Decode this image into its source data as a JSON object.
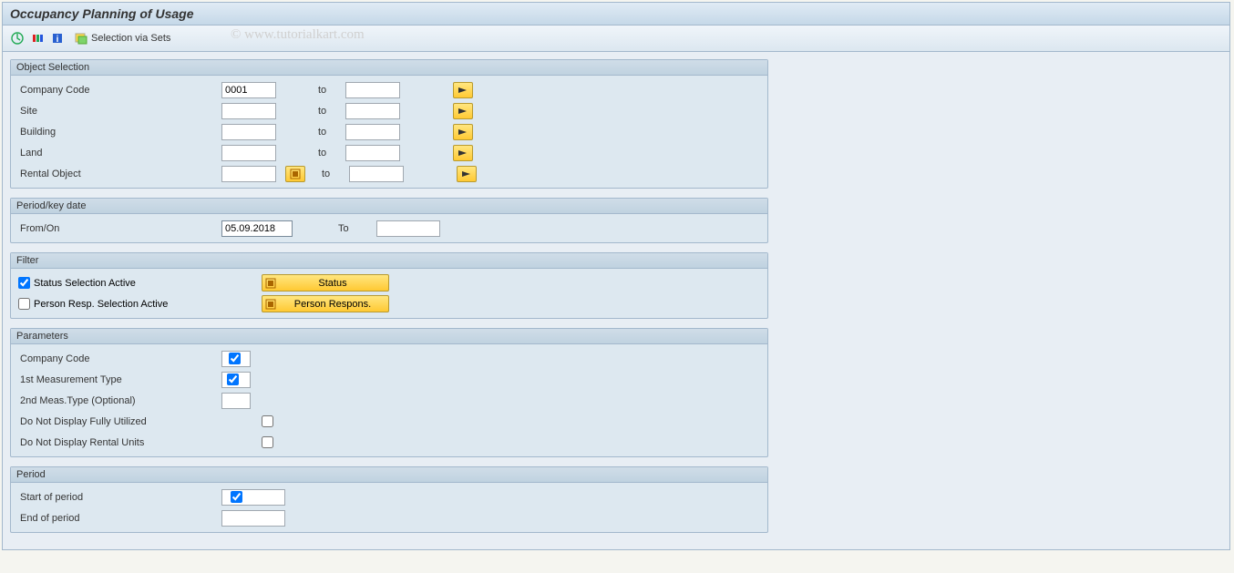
{
  "title": "Occupancy Planning of Usage",
  "toolbar": {
    "selection_via_sets": "Selection via Sets"
  },
  "watermark": "© www.tutorialkart.com",
  "groups": {
    "object_selection": {
      "title": "Object Selection",
      "rows": {
        "company_code": {
          "label": "Company Code",
          "from": "0001",
          "to_label": "to",
          "to": ""
        },
        "site": {
          "label": "Site",
          "from": "",
          "to_label": "to",
          "to": ""
        },
        "building": {
          "label": "Building",
          "from": "",
          "to_label": "to",
          "to": ""
        },
        "land": {
          "label": "Land",
          "from": "",
          "to_label": "to",
          "to": ""
        },
        "rental_object": {
          "label": "Rental Object",
          "from": "",
          "to_label": "to",
          "to": ""
        }
      }
    },
    "period_key_date": {
      "title": "Period/key date",
      "from_on_label": "From/On",
      "from_on_value": "05.09.2018",
      "to_label": "To",
      "to_value": ""
    },
    "filter": {
      "title": "Filter",
      "status_sel_label": "Status Selection Active",
      "status_btn": "Status",
      "person_sel_label": "Person Resp. Selection Active",
      "person_btn": "Person Respons."
    },
    "parameters": {
      "title": "Parameters",
      "company_code": "Company Code",
      "meas1": "1st Measurement Type",
      "meas2": "2nd Meas.Type (Optional)",
      "no_full": "Do Not Display Fully Utilized",
      "no_rental": "Do Not Display Rental Units"
    },
    "period": {
      "title": "Period",
      "start": "Start of period",
      "end": "End of period"
    }
  }
}
